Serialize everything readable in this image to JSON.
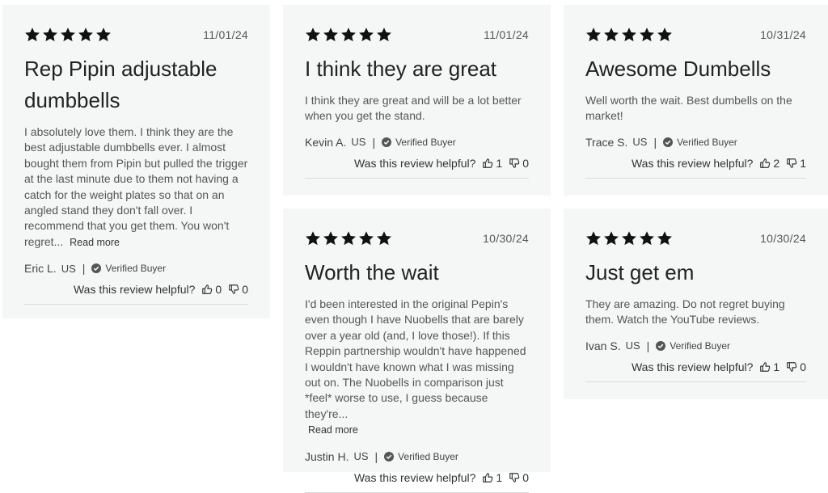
{
  "reviews": [
    {
      "date": "11/01/24",
      "title": "Rep Pipin adjustable dumbbells",
      "body": "I absolutely love them. I think they are the best adjustable dumbbells ever. I almost bought them from Pipin but pulled the trigger at the last minute due to them not having a catch for the weight plates so that on an angled stand they don't fall over. I recommend that you get them. You won't regret...",
      "read_more": "Read more",
      "author": "Eric L.",
      "country": "US",
      "verified": "Verified Buyer",
      "helpful_label": "Was this review helpful?",
      "up": "0",
      "down": "0"
    },
    {
      "date": "11/01/24",
      "title": "I think they are great",
      "body": "I think they are great and will be a lot better when you get the stand.",
      "author": "Kevin A.",
      "country": "US",
      "verified": "Verified Buyer",
      "helpful_label": "Was this review helpful?",
      "up": "1",
      "down": "0"
    },
    {
      "date": "10/31/24",
      "title": "Awesome Dumbells",
      "body": "Well worth the wait. Best dumbells on the market!",
      "author": "Trace S.",
      "country": "US",
      "verified": "Verified Buyer",
      "helpful_label": "Was this review helpful?",
      "up": "2",
      "down": "1"
    },
    {
      "date": "10/30/24",
      "title": "Worth the wait",
      "body": "I'd been interested in the original Pepin's even though I have Nuobells that are barely over a year old (and, I love those!). If this Reppin partnership wouldn't have happened I wouldn't have known what I was missing out on. The Nuobells in comparison just *feel* worse to use, I guess because they're...",
      "read_more": "Read more",
      "author": "Justin H.",
      "country": "US",
      "verified": "Verified Buyer",
      "helpful_label": "Was this review helpful?",
      "up": "1",
      "down": "0"
    },
    {
      "date": "10/30/24",
      "title": "Just get em",
      "body": "They are amazing. Do not regret buying them. Watch the YouTube reviews.",
      "author": "Ivan S.",
      "country": "US",
      "verified": "Verified Buyer",
      "helpful_label": "Was this review helpful?",
      "up": "1",
      "down": "0"
    }
  ],
  "rating": {
    "stars": 5,
    "max": 5
  },
  "separator": "|",
  "icons": {
    "star": "star-icon",
    "verified": "verified-check-icon",
    "thumbs_up": "thumbs-up-icon",
    "thumbs_down": "thumbs-down-icon"
  },
  "colors": {
    "card_bg": "#f5f6f6",
    "star": "#111111",
    "text": "#555555",
    "divider": "#dcdcdc"
  }
}
